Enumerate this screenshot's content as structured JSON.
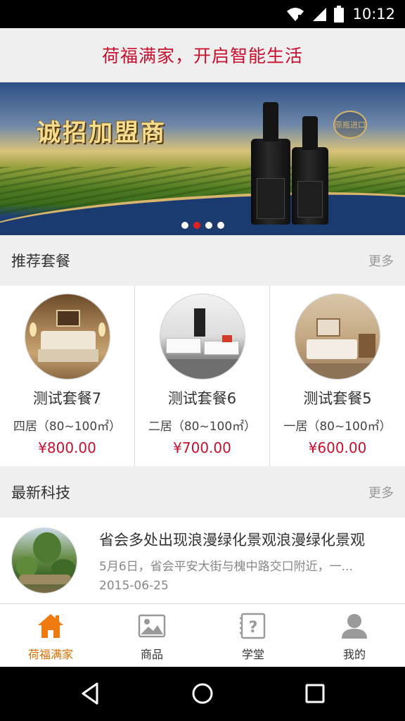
{
  "status_bar": {
    "time": "10:12"
  },
  "header": {
    "title": "荷福满家，开启智能生活"
  },
  "banner": {
    "headline": "诚招加盟商",
    "seal_text": "原瓶进口",
    "slide_count": 4,
    "active_slide": 2
  },
  "recommend": {
    "title": "推荐套餐",
    "more": "更多",
    "items": [
      {
        "name": "测试套餐7",
        "size": "四居（80~100㎡）",
        "price": "¥800.00"
      },
      {
        "name": "测试套餐6",
        "size": "二居（80~100㎡）",
        "price": "¥700.00"
      },
      {
        "name": "测试套餐5",
        "size": "一居（80~100㎡）",
        "price": "¥600.00"
      }
    ]
  },
  "tech": {
    "title": "最新科技",
    "more": "更多",
    "items": [
      {
        "title": "省会多处出现浪漫绿化景观浪漫绿化景观",
        "summary": "5月6日，省会平安大街与槐中路交口附近，一...",
        "date": "2015-06-25"
      }
    ]
  },
  "tabs": [
    {
      "label": "荷福满家",
      "icon": "home-icon",
      "active": true
    },
    {
      "label": "商品",
      "icon": "image-icon",
      "active": false
    },
    {
      "label": "学堂",
      "icon": "question-book-icon",
      "active": false
    },
    {
      "label": "我的",
      "icon": "person-icon",
      "active": false
    }
  ],
  "colors": {
    "accent_red": "#c8102e",
    "tab_active": "#e07000",
    "price": "#c8102e"
  }
}
